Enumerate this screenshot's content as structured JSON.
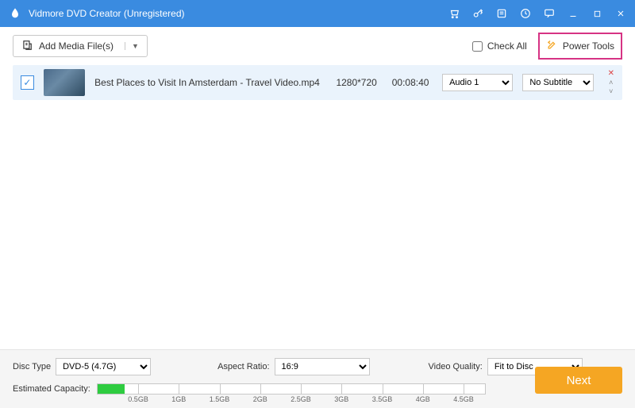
{
  "titlebar": {
    "title": "Vidmore DVD Creator (Unregistered)"
  },
  "toolbar": {
    "add_label": "Add Media File(s)",
    "check_all_label": "Check All",
    "power_tools_label": "Power Tools"
  },
  "items": [
    {
      "checked": true,
      "filename": "Best Places to Visit In Amsterdam - Travel Video.mp4",
      "resolution": "1280*720",
      "duration": "00:08:40",
      "audio": "Audio 1",
      "subtitle": "No Subtitle"
    }
  ],
  "bottom": {
    "disc_type_label": "Disc Type",
    "disc_type_value": "DVD-5 (4.7G)",
    "aspect_label": "Aspect Ratio:",
    "aspect_value": "16:9",
    "vq_label": "Video Quality:",
    "vq_value": "Fit to Disc",
    "cap_label": "Estimated Capacity:",
    "ticks": [
      "0.5GB",
      "1GB",
      "1.5GB",
      "2GB",
      "2.5GB",
      "3GB",
      "3.5GB",
      "4GB",
      "4.5GB"
    ],
    "next_label": "Next"
  }
}
